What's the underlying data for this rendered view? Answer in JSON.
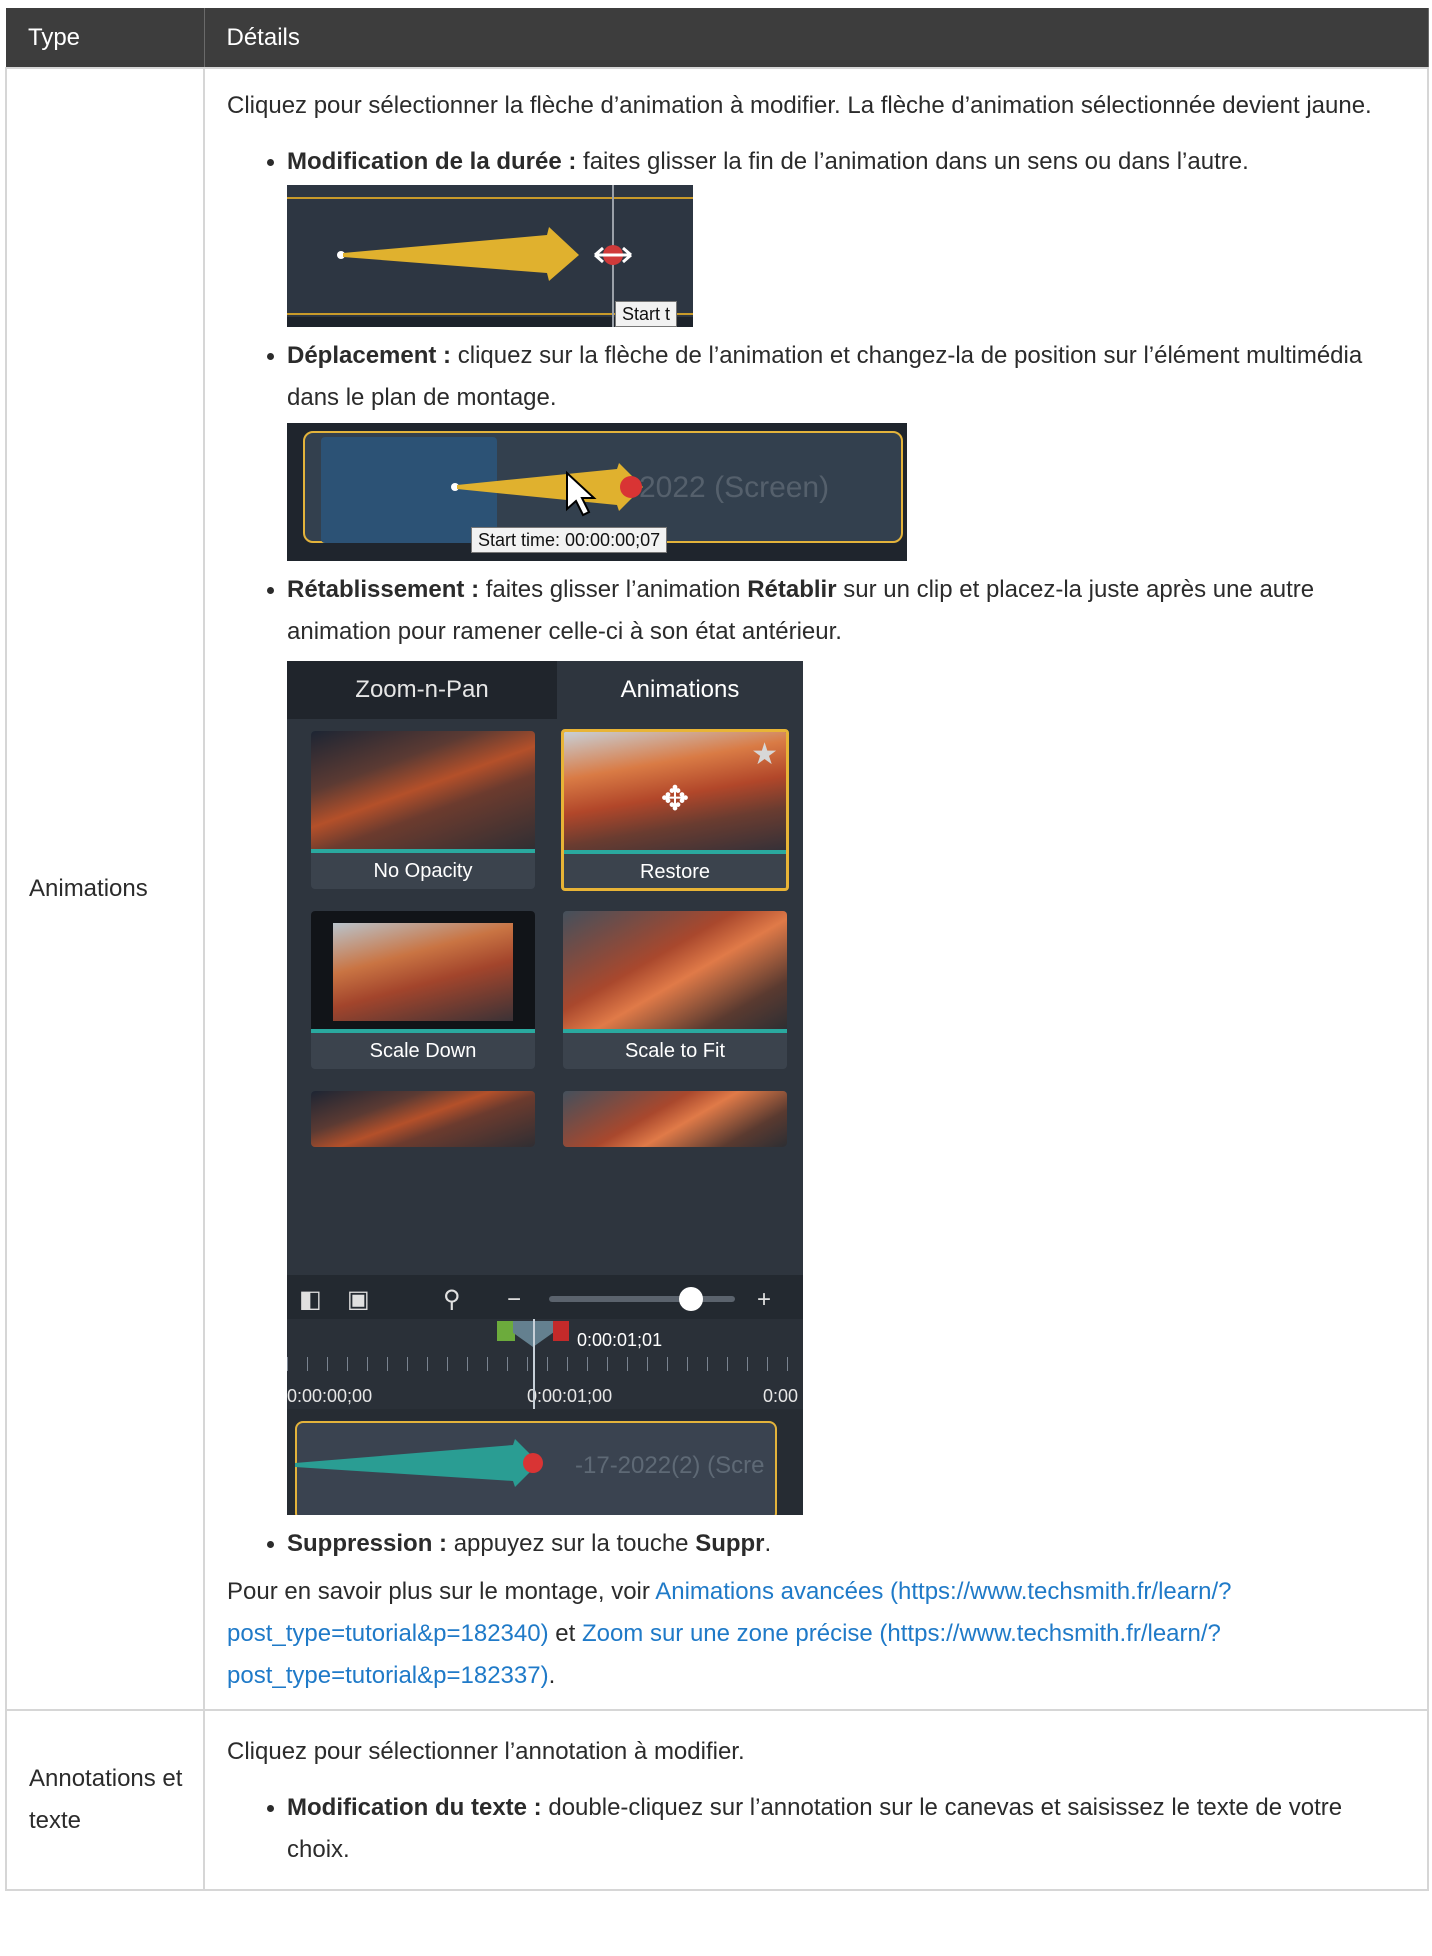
{
  "table": {
    "headers": {
      "type": "Type",
      "details": "Détails"
    },
    "rows": [
      {
        "type": "Animations",
        "intro": "Cliquez pour sélectionner la flèche d’animation à modifier. La flèche d’animation sélectionnée devient jaune.",
        "bullets": [
          {
            "bold": "Modification de la durée :",
            "text": " faites glisser la fin de l’animation dans un sens ou dans l’autre."
          },
          {
            "bold": "Déplacement :",
            "text": " cliquez sur la flèche de l’animation et changez-la de position sur l’élément multimédia dans le plan de montage."
          },
          {
            "bold": "Rétablissement :",
            "text_a": " faites glisser l’animation ",
            "bold2": "Rétablir",
            "text_b": " sur un clip et placez-la juste après une autre animation pour ramener celle-ci à son état antérieur."
          },
          {
            "bold": "Suppression :",
            "text_a": " appuyez sur la touche ",
            "bold2": "Suppr",
            "text_b": "."
          }
        ],
        "outro": {
          "prefix": "Pour en savoir plus sur le montage, voir ",
          "link1": "Animations avancées (https://www.techsmith.fr/learn/?post_type=tutorial&p=182340)",
          "middle": " et ",
          "link2": "Zoom sur une zone précise (https://www.techsmith.fr/learn/?post_type=tutorial&p=182337)",
          "suffix": "."
        }
      },
      {
        "type": "Annotations et texte",
        "intro": "Cliquez pour sélectionner l’annotation à modifier.",
        "bullets": [
          {
            "bold": "Modification du texte :",
            "text": " double-cliquez sur l’annotation sur le canevas et saisissez le texte de votre choix."
          }
        ]
      }
    ]
  },
  "illustration_duration": {
    "tooltip": "Start t"
  },
  "illustration_move": {
    "clip_name": "2022 (Screen)",
    "tooltip": "Start time:   00:00:00;07"
  },
  "illustration_restore": {
    "tabs": [
      "Zoom-n-Pan",
      "Animations"
    ],
    "cards": [
      "No Opacity",
      "Restore",
      "Scale Down",
      "Scale to Fit"
    ],
    "playhead_time": "0:00:01;01",
    "ruler_labels": [
      "0:00:00;00",
      "0:00:01;00",
      "0:00"
    ],
    "clip_name": "-17-2022(2) (Scre",
    "colors": {
      "selected_border": "#e8b436",
      "teal": "#2aa99f",
      "arrow_yellow": "#e0b12e",
      "arrow_teal": "#2a9d93"
    }
  }
}
